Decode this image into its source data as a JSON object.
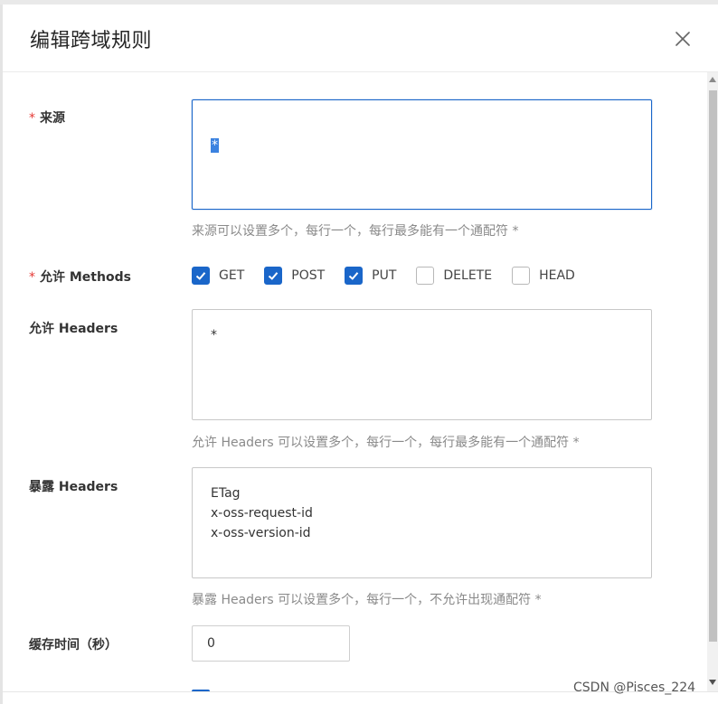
{
  "dialog": {
    "title": "编辑跨域规则",
    "close_icon": "close-icon"
  },
  "form": {
    "origin": {
      "required_mark": "*",
      "label": "来源",
      "value": "*",
      "hint": "来源可以设置多个，每行一个，每行最多能有一个通配符 *"
    },
    "methods": {
      "required_mark": "*",
      "label": "允许 Methods",
      "options": [
        {
          "label": "GET",
          "checked": true
        },
        {
          "label": "POST",
          "checked": true
        },
        {
          "label": "PUT",
          "checked": true
        },
        {
          "label": "DELETE",
          "checked": false
        },
        {
          "label": "HEAD",
          "checked": false
        }
      ]
    },
    "allow_headers": {
      "label": "允许 Headers",
      "value": "*",
      "hint": "允许 Headers 可以设置多个，每行一个，每行最多能有一个通配符 *"
    },
    "expose_headers": {
      "label": "暴露 Headers",
      "value": "ETag\nx-oss-request-id\nx-oss-version-id",
      "hint": "暴露 Headers 可以设置多个，每行一个，不允许出现通配符 *"
    },
    "cache_time": {
      "label": "缓存时间（秒）",
      "value": "0"
    }
  },
  "watermark": "CSDN @Pisces_224",
  "colors": {
    "accent": "#1a66c9",
    "required": "#e53935",
    "hint": "#8a8a8a"
  }
}
